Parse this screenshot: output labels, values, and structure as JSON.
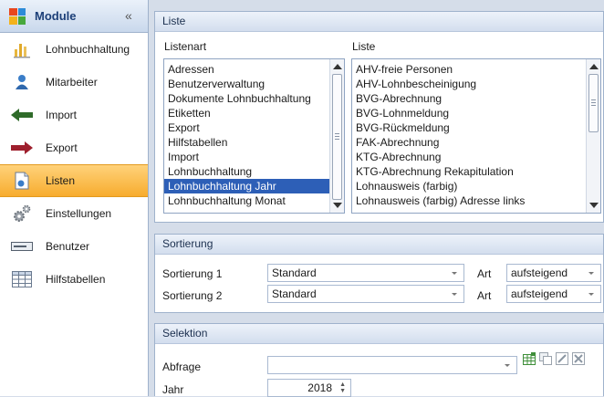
{
  "sidebar": {
    "title": "Module",
    "collapse_glyph": "«",
    "items": [
      {
        "label": "Lohnbuchhaltung",
        "icon": "ledger-bars-icon"
      },
      {
        "label": "Mitarbeiter",
        "icon": "employee-icon"
      },
      {
        "label": "Import",
        "icon": "arrow-left-icon"
      },
      {
        "label": "Export",
        "icon": "arrow-right-icon"
      },
      {
        "label": "Listen",
        "icon": "list-document-icon",
        "active": true
      },
      {
        "label": "Einstellungen",
        "icon": "gears-icon"
      },
      {
        "label": "Benutzer",
        "icon": "user-card-icon"
      },
      {
        "label": "Hilfstabellen",
        "icon": "table-icon"
      }
    ]
  },
  "liste": {
    "header": "Liste",
    "listenart_label": "Listenart",
    "liste_label": "Liste",
    "listenart_items": [
      "Adressen",
      "Benutzerverwaltung",
      "Dokumente Lohnbuchhaltung",
      "Etiketten",
      "Export",
      "Hilfstabellen",
      "Import",
      "Lohnbuchhaltung",
      "Lohnbuchhaltung Jahr",
      "Lohnbuchhaltung Monat"
    ],
    "listenart_selected": "Lohnbuchhaltung Jahr",
    "liste_items": [
      "AHV-freie Personen",
      "AHV-Lohnbescheinigung",
      "BVG-Abrechnung",
      "BVG-Lohnmeldung",
      "BVG-Rückmeldung",
      "FAK-Abrechnung",
      "KTG-Abrechnung",
      "KTG-Abrechnung Rekapitulation",
      "Lohnausweis (farbig)",
      "Lohnausweis (farbig) Adresse links"
    ]
  },
  "sortierung": {
    "header": "Sortierung",
    "rows": [
      {
        "label": "Sortierung 1",
        "value": "Standard",
        "art_label": "Art",
        "art_value": "aufsteigend"
      },
      {
        "label": "Sortierung 2",
        "value": "Standard",
        "art_label": "Art",
        "art_value": "aufsteigend"
      }
    ]
  },
  "selektion": {
    "header": "Selektion",
    "abfrage_label": "Abfrage",
    "abfrage_value": "",
    "jahr_label": "Jahr",
    "jahr_value": "2018",
    "toolbar_icons": [
      "new-query-icon",
      "copy-query-icon",
      "edit-query-icon",
      "delete-query-icon"
    ]
  },
  "colors": {
    "accent_active": "#f7ac2e",
    "selection": "#2d5fb7",
    "panel_border": "#9fb2cc",
    "background": "#d5dde9"
  }
}
